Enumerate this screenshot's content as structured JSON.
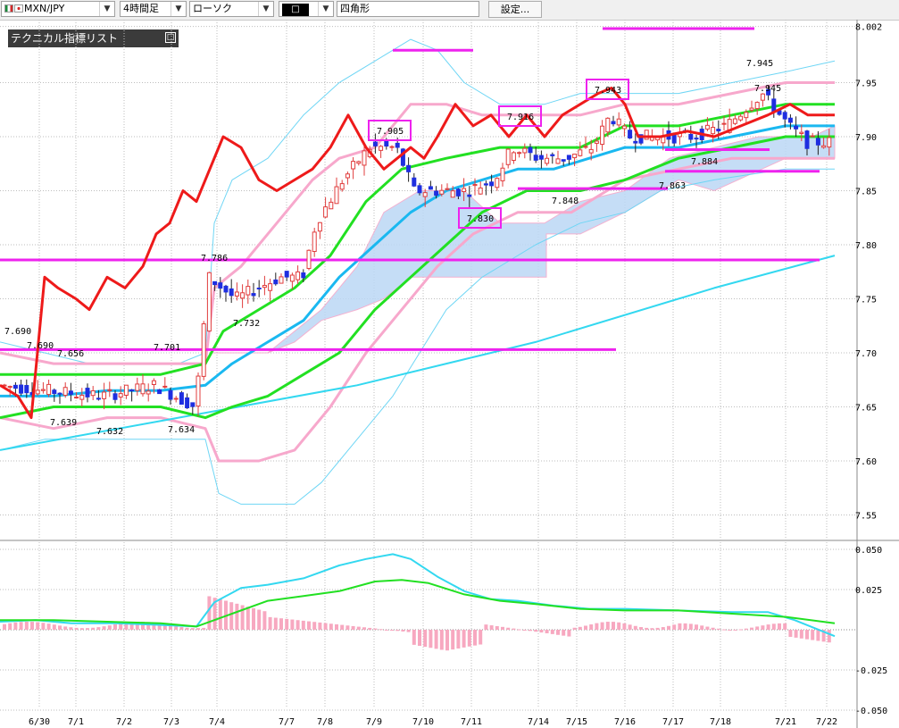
{
  "toolbar": {
    "pair": "MXN/JPY",
    "timeframe": "4時間足",
    "chart_style": "ローソク",
    "color_swatch": "□",
    "drawing_tool": "四角形",
    "settings_label": "設定..."
  },
  "panel": {
    "title": "テクニカル指標リスト",
    "toggle": "□"
  },
  "colors": {
    "up_candle": "#e03c3c",
    "down_candle": "#1e2ee0",
    "red_line": "#ee1a1a",
    "ma_short": "#1ab8f0",
    "ma_mid": "#22e022",
    "ma_long_cyan": "#33d8f0",
    "bollinger_outer": "#6fd6f5",
    "bollinger_inner": "#f7a8cc",
    "level_lines": "#ee22ee",
    "cloud": "#bcd8f5",
    "grid": "#bdbdbd"
  },
  "chart_data": {
    "type": "candlestick",
    "price_axis": {
      "range": [
        7.55,
        8.002
      ],
      "ticks": [
        "8.002",
        "7.95",
        "7.90",
        "7.85",
        "7.80",
        "7.75",
        "7.70",
        "7.65",
        "7.60",
        "7.55"
      ]
    },
    "macd_axis": {
      "range": [
        -0.05,
        0.05
      ],
      "ticks": [
        "0.050",
        "0.025",
        "-0.025",
        "-0.050"
      ]
    },
    "x_ticks": [
      "6/30",
      "7/1",
      "7/2",
      "7/3",
      "7/4",
      "7/7",
      "7/8",
      "7/9",
      "7/10",
      "7/11",
      "7/14",
      "7/15",
      "7/16",
      "7/17",
      "7/18",
      "7/21",
      "7/22"
    ],
    "annotations": [
      {
        "label": "7.690",
        "value": 7.69
      },
      {
        "label": "7.690",
        "value": 7.69
      },
      {
        "label": "7.656",
        "value": 7.656
      },
      {
        "label": "7.701",
        "value": 7.701
      },
      {
        "label": "7.639",
        "value": 7.639
      },
      {
        "label": "7.632",
        "value": 7.632
      },
      {
        "label": "7.634",
        "value": 7.634
      },
      {
        "label": "7.786",
        "value": 7.786
      },
      {
        "label": "7.732",
        "value": 7.732
      },
      {
        "label": "7.905",
        "value": 7.905,
        "boxed": true
      },
      {
        "label": "7.830",
        "value": 7.83,
        "boxed": true
      },
      {
        "label": "7.916",
        "value": 7.916,
        "boxed": true
      },
      {
        "label": "7.848",
        "value": 7.848
      },
      {
        "label": "7.943",
        "value": 7.943,
        "boxed": true
      },
      {
        "label": "7.863",
        "value": 7.863
      },
      {
        "label": "7.884",
        "value": 7.884
      },
      {
        "label": "7.945",
        "value": 7.945
      },
      {
        "label": "7.945",
        "value": 7.945
      }
    ],
    "horizontal_levels": [
      {
        "value": 7.703,
        "from": 0,
        "to": 690
      },
      {
        "value": 7.786,
        "from": 0,
        "to": 918
      },
      {
        "value": 7.98,
        "from": 440,
        "to": 530
      },
      {
        "value": 8.0,
        "from": 675,
        "to": 845
      },
      {
        "value": 7.852,
        "from": 580,
        "to": 748
      },
      {
        "value": 7.888,
        "from": 745,
        "to": 862
      },
      {
        "value": 7.868,
        "from": 745,
        "to": 918
      }
    ],
    "macd": {
      "histogram_style": "pink bars",
      "lines": [
        "cyan",
        "green"
      ]
    }
  }
}
